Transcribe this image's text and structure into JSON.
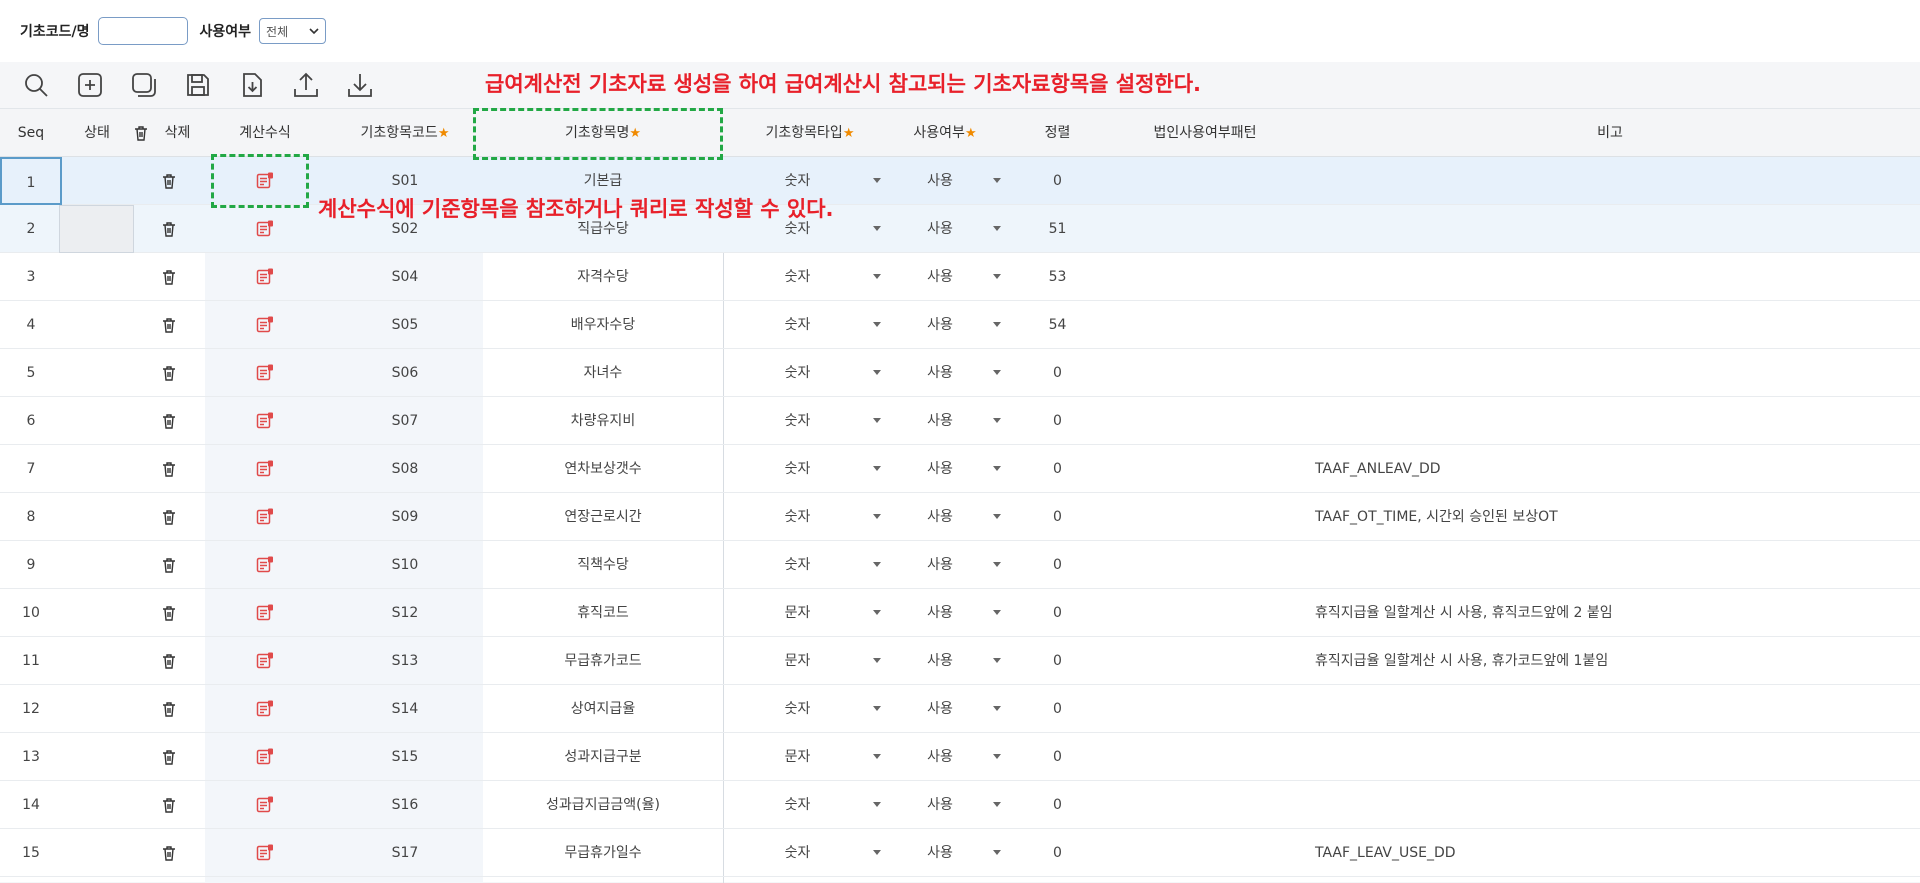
{
  "search": {
    "code_label": "기초코드/명",
    "code_value": "",
    "use_label": "사용여부",
    "use_selected": "전체"
  },
  "annotations": {
    "top": "급여계산전 기초자료 생성을 하여 급여계산시 참고되는 기초자료항목을 설정한다.",
    "formula": "계산수식에 기준항목을 참조하거나 쿼리로 작성할 수 있다."
  },
  "toolbar": [
    "search-icon",
    "add-icon",
    "copy-icon",
    "save-icon",
    "download-template-icon",
    "upload-icon",
    "download-icon"
  ],
  "columns": {
    "seq": "Seq",
    "status": "상태",
    "delete": "삭제",
    "formula": "계산수식",
    "code": "기초항목코드",
    "name": "기초항목명",
    "type": "기초항목타입",
    "use": "사용여부",
    "order": "정렬",
    "pattern": "법인사용여부패턴",
    "note": "비고"
  },
  "rows": [
    {
      "seq": "1",
      "code": "S01",
      "name": "기본급",
      "type": "숫자",
      "use": "사용",
      "order": "0",
      "note": ""
    },
    {
      "seq": "2",
      "code": "S02",
      "name": "직급수당",
      "type": "숫자",
      "use": "사용",
      "order": "51",
      "note": ""
    },
    {
      "seq": "3",
      "code": "S04",
      "name": "자격수당",
      "type": "숫자",
      "use": "사용",
      "order": "53",
      "note": ""
    },
    {
      "seq": "4",
      "code": "S05",
      "name": "배우자수당",
      "type": "숫자",
      "use": "사용",
      "order": "54",
      "note": ""
    },
    {
      "seq": "5",
      "code": "S06",
      "name": "자녀수",
      "type": "숫자",
      "use": "사용",
      "order": "0",
      "note": ""
    },
    {
      "seq": "6",
      "code": "S07",
      "name": "차량유지비",
      "type": "숫자",
      "use": "사용",
      "order": "0",
      "note": ""
    },
    {
      "seq": "7",
      "code": "S08",
      "name": "연차보상갯수",
      "type": "숫자",
      "use": "사용",
      "order": "0",
      "note": "TAAF_ANLEAV_DD"
    },
    {
      "seq": "8",
      "code": "S09",
      "name": "연장근로시간",
      "type": "숫자",
      "use": "사용",
      "order": "0",
      "note": "TAAF_OT_TIME, 시간외 승인된 보상OT"
    },
    {
      "seq": "9",
      "code": "S10",
      "name": "직책수당",
      "type": "숫자",
      "use": "사용",
      "order": "0",
      "note": ""
    },
    {
      "seq": "10",
      "code": "S12",
      "name": "휴직코드",
      "type": "문자",
      "use": "사용",
      "order": "0",
      "note": "휴직지급율 일할계산 시 사용, 휴직코드앞에 2 붙임"
    },
    {
      "seq": "11",
      "code": "S13",
      "name": "무급휴가코드",
      "type": "문자",
      "use": "사용",
      "order": "0",
      "note": "휴직지급율 일할계산 시 사용, 휴가코드앞에 1붙임"
    },
    {
      "seq": "12",
      "code": "S14",
      "name": "상여지급율",
      "type": "숫자",
      "use": "사용",
      "order": "0",
      "note": ""
    },
    {
      "seq": "13",
      "code": "S15",
      "name": "성과지급구분",
      "type": "문자",
      "use": "사용",
      "order": "0",
      "note": ""
    },
    {
      "seq": "14",
      "code": "S16",
      "name": "성과급지급금액(율)",
      "type": "숫자",
      "use": "사용",
      "order": "0",
      "note": ""
    },
    {
      "seq": "15",
      "code": "S17",
      "name": "무급휴가일수",
      "type": "숫자",
      "use": "사용",
      "order": "0",
      "note": "TAAF_LEAV_USE_DD"
    }
  ]
}
